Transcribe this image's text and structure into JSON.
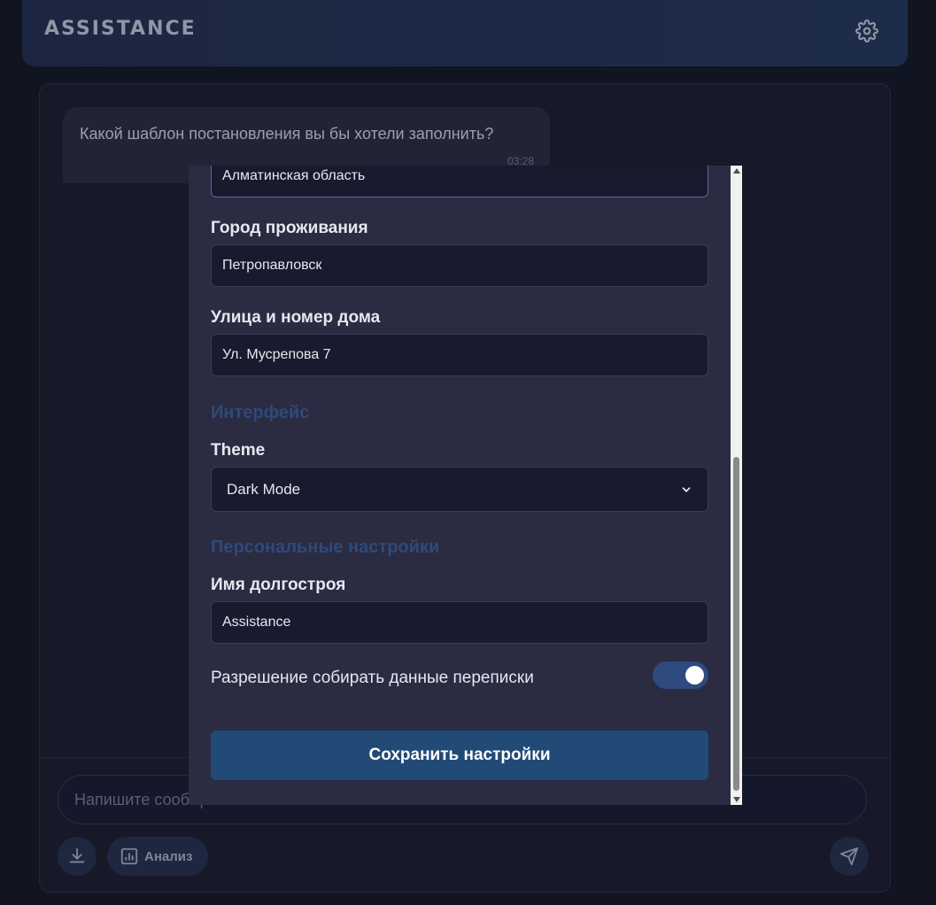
{
  "header": {
    "title": "ASSISTANCE",
    "settings_icon": "gear-icon"
  },
  "chat": {
    "messages": [
      {
        "text": "Какой шаблон постановления вы бы хотели заполнить?",
        "time": "03:28"
      }
    ]
  },
  "composer": {
    "placeholder": "Напишите сообщение...",
    "download_icon": "download-icon",
    "analysis_label": "Анализ",
    "analysis_icon": "chart-icon",
    "send_icon": "send-icon"
  },
  "settings_modal": {
    "region_value": "Алматинская область",
    "city_label": "Город проживания",
    "city_value": "Петропавловск",
    "street_label": "Улица и номер дома",
    "street_value": "Ул. Мусрепова 7",
    "interface_section": "Интерфейс",
    "theme_label": "Theme",
    "theme_value": "Dark Mode",
    "personal_section": "Персональные настройки",
    "name_label": "Имя долгостроя",
    "name_value": "Assistance",
    "consent_label": "Разрешение собирать данные переписки",
    "consent_enabled": true,
    "save_label": "Сохранить настройки"
  },
  "colors": {
    "background": "#111522",
    "panel": "#171928",
    "modal": "#2b2b42",
    "accent": "#224a76",
    "section_title": "#2e4a7a"
  }
}
